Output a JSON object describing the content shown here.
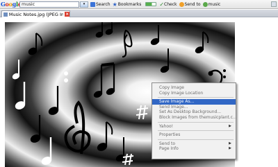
{
  "toolbar": {
    "logo": "Google",
    "search_value": "music",
    "items": [
      {
        "label": "Search",
        "icon": "search-icon"
      },
      {
        "label": "Bookmarks",
        "icon": "star-icon"
      },
      {
        "label": "PageRank",
        "icon": "pagerank-icon"
      },
      {
        "label": "Check",
        "icon": "spellcheck-icon"
      },
      {
        "label": "Send to",
        "icon": "send-icon"
      },
      {
        "label": "music",
        "icon": "highlight-icon"
      }
    ]
  },
  "tab": {
    "title": "Music Notes.jpg (JPEG Imag"
  },
  "context_menu": {
    "items": [
      {
        "label": "Copy Image",
        "state": "enabled"
      },
      {
        "label": "Copy Image Location",
        "state": "enabled"
      },
      {
        "separator": true
      },
      {
        "label": "Save Image As...",
        "state": "highlighted"
      },
      {
        "label": "Send Image...",
        "state": "enabled"
      },
      {
        "label": "Set As Desktop Background...",
        "state": "enabled"
      },
      {
        "label": "Block Images from themusicplant.c...",
        "state": "enabled"
      },
      {
        "separator": true
      },
      {
        "label": "Yahoo!",
        "state": "enabled",
        "submenu": true
      },
      {
        "separator": true
      },
      {
        "label": "Properties",
        "state": "enabled"
      },
      {
        "separator": true
      },
      {
        "label": "Send to",
        "state": "enabled",
        "submenu": true
      },
      {
        "label": "Page Info",
        "state": "enabled",
        "submenu": true
      }
    ]
  },
  "colors": {
    "menu_highlight": "#3167c5",
    "tab_close": "#d93a2b"
  }
}
